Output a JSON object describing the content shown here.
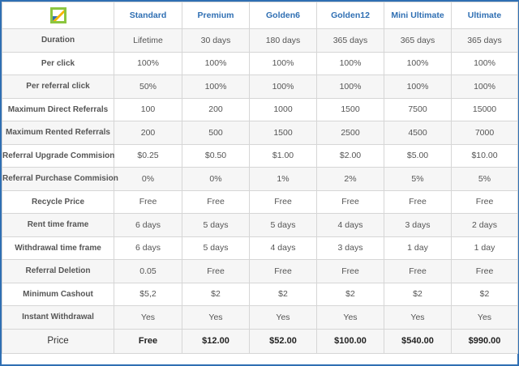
{
  "columns": [
    "Standard",
    "Premium",
    "Golden6",
    "Golden12",
    "Mini Ultimate",
    "Ultimate"
  ],
  "rows": [
    {
      "label": "Duration",
      "values": [
        "Lifetime",
        "30 days",
        "180 days",
        "365 days",
        "365 days",
        "365 days"
      ]
    },
    {
      "label": "Per click",
      "values": [
        "100%",
        "100%",
        "100%",
        "100%",
        "100%",
        "100%"
      ]
    },
    {
      "label": "Per referral click",
      "values": [
        "50%",
        "100%",
        "100%",
        "100%",
        "100%",
        "100%"
      ]
    },
    {
      "label": "Maximum Direct Referrals",
      "values": [
        "100",
        "200",
        "1000",
        "1500",
        "7500",
        "15000"
      ]
    },
    {
      "label": "Maximum Rented Referrals",
      "values": [
        "200",
        "500",
        "1500",
        "2500",
        "4500",
        "7000"
      ]
    },
    {
      "label": "Referral Upgrade Commision",
      "values": [
        "$0.25",
        "$0.50",
        "$1.00",
        "$2.00",
        "$5.00",
        "$10.00"
      ]
    },
    {
      "label": "Referral Purchase Commision",
      "values": [
        "0%",
        "0%",
        "1%",
        "2%",
        "5%",
        "5%"
      ]
    },
    {
      "label": "Recycle Price",
      "values": [
        "Free",
        "Free",
        "Free",
        "Free",
        "Free",
        "Free"
      ]
    },
    {
      "label": "Rent time frame",
      "values": [
        "6 days",
        "5 days",
        "5 days",
        "4 days",
        "3 days",
        "2 days"
      ]
    },
    {
      "label": "Withdrawal time frame",
      "values": [
        "6 days",
        "5 days",
        "4 days",
        "3 days",
        "1 day",
        "1 day"
      ]
    },
    {
      "label": "Referral Deletion",
      "values": [
        "0.05",
        "Free",
        "Free",
        "Free",
        "Free",
        "Free"
      ]
    },
    {
      "label": "Minimum Cashout",
      "values": [
        "$5,2",
        "$2",
        "$2",
        "$2",
        "$2",
        "$2"
      ]
    },
    {
      "label": "Instant Withdrawal",
      "values": [
        "Yes",
        "Yes",
        "Yes",
        "Yes",
        "Yes",
        "Yes"
      ]
    }
  ],
  "price": {
    "label": "Price",
    "values": [
      "Free",
      "$12.00",
      "$52.00",
      "$100.00",
      "$540.00",
      "$990.00"
    ]
  },
  "logo": {
    "icon": "brand-logo-icon",
    "colors": [
      "#8cc63f",
      "#f7b500",
      "#2f6fb3"
    ]
  }
}
